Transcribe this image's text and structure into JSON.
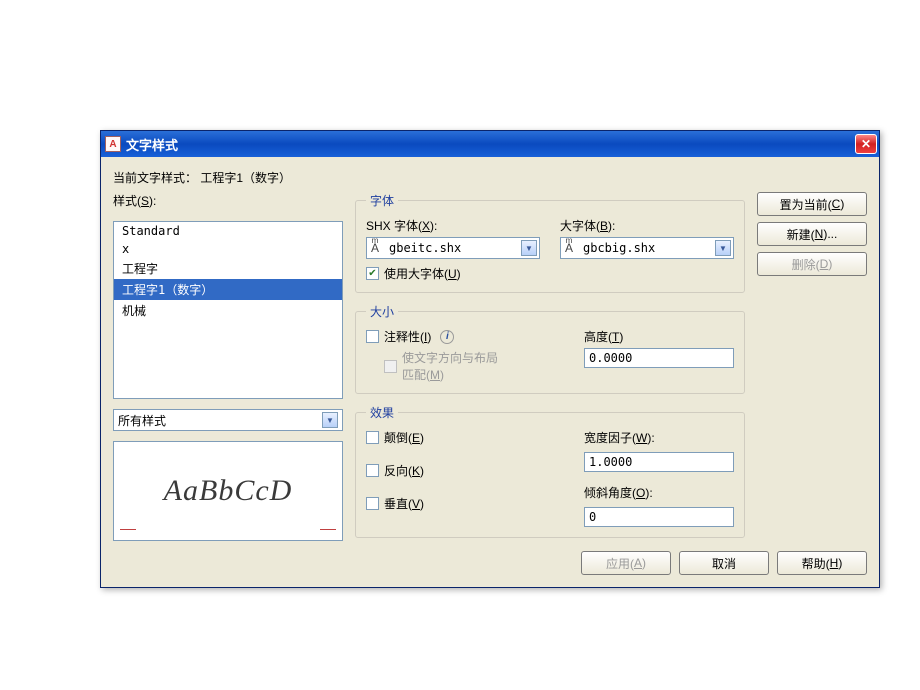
{
  "title": "文字样式",
  "current_style_label": "当前文字样式：",
  "current_style_value": "工程字1（数字）",
  "styles_label": "样式(S):",
  "styles_items": [
    "Standard",
    "x",
    "工程字",
    "工程字1（数字）",
    "机械"
  ],
  "styles_selected": "工程字1（数字）",
  "filter_value": "所有样式",
  "preview_text": "AaBbCcD",
  "font": {
    "legend": "字体",
    "shx_label": "SHX 字体(X):",
    "shx_value": "gbeitc.shx",
    "big_label": "大字体(B):",
    "big_value": "gbcbig.shx",
    "use_big_label": "使用大字体(U)",
    "use_big_checked": true
  },
  "size": {
    "legend": "大小",
    "annotative_label": "注释性(I)",
    "annotative_checked": false,
    "orient_label": "使文字方向与布局匹配(M)",
    "height_label": "高度(T)",
    "height_value": "0.0000"
  },
  "effects": {
    "legend": "效果",
    "upside_label": "颠倒(E)",
    "upside_checked": false,
    "backwards_label": "反向(K)",
    "backwards_checked": false,
    "vertical_label": "垂直(V)",
    "vertical_checked": false,
    "width_label": "宽度因子(W):",
    "width_value": "1.0000",
    "oblique_label": "倾斜角度(O):",
    "oblique_value": "0"
  },
  "buttons": {
    "set_current": "置为当前(C)",
    "new": "新建(N)...",
    "delete": "删除(D)",
    "apply": "应用(A)",
    "cancel": "取消",
    "help": "帮助(H)"
  }
}
